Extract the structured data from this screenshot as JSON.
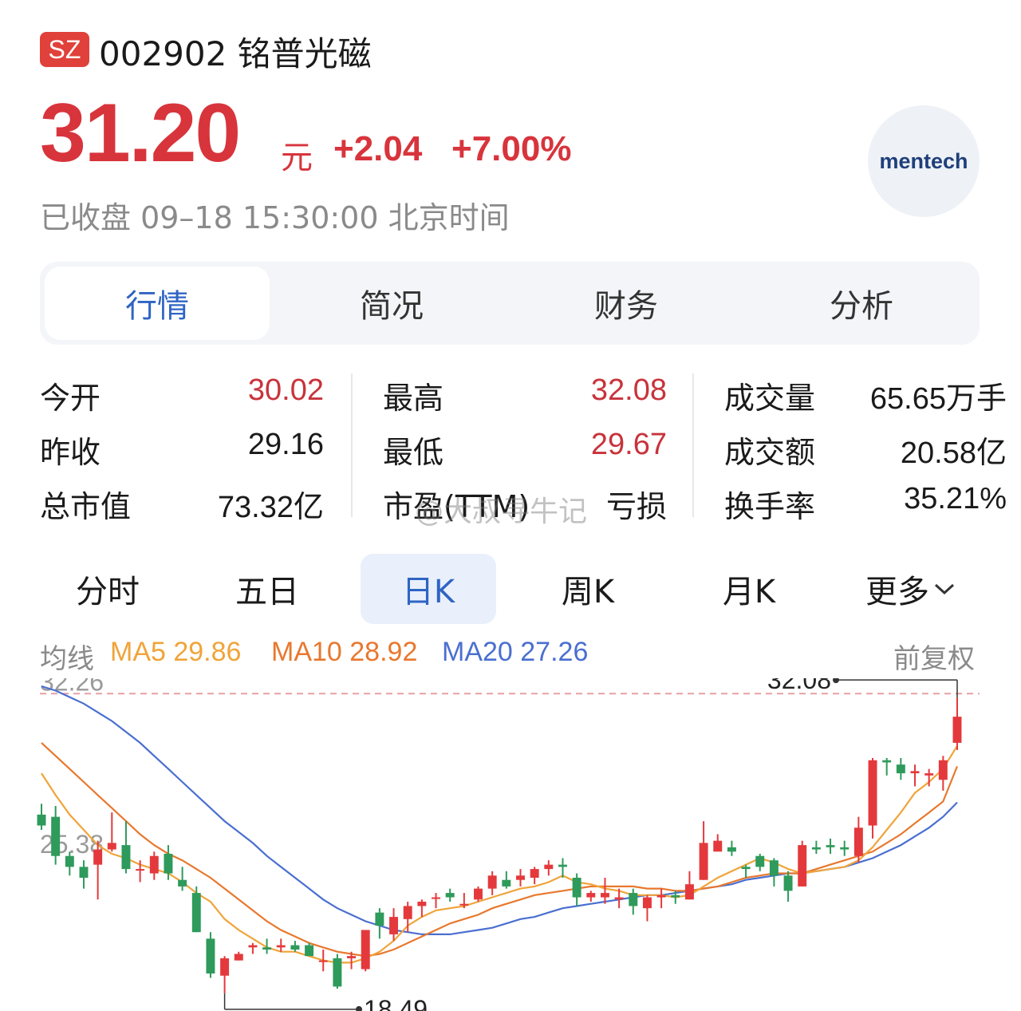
{
  "header": {
    "market_badge": "SZ",
    "code_name": "002902 铭普光磁",
    "price": "31.20",
    "price_unit": "元",
    "change": "+2.04",
    "change_pct": "+7.00%",
    "status": "已收盘 09–18 15:30:00 北京时间",
    "logo_text": "mentech"
  },
  "tabs": [
    {
      "label": "行情",
      "active": true
    },
    {
      "label": "简况",
      "active": false
    },
    {
      "label": "财务",
      "active": false
    },
    {
      "label": "分析",
      "active": false
    }
  ],
  "stats": [
    {
      "label": "今开",
      "value": "30.02",
      "color": "red"
    },
    {
      "label": "昨收",
      "value": "29.16",
      "color": "black"
    },
    {
      "label": "总市值",
      "value": "73.32亿",
      "color": "black"
    },
    {
      "label": "最高",
      "value": "32.08",
      "color": "red"
    },
    {
      "label": "最低",
      "value": "29.67",
      "color": "red"
    },
    {
      "label": "市盈(TTM)",
      "value": "亏损",
      "color": "black"
    },
    {
      "label": "成交量",
      "value": "65.65万手",
      "color": "black"
    },
    {
      "label": "成交额",
      "value": "20.58亿",
      "color": "black"
    },
    {
      "label": "换手率",
      "value": "35.21%",
      "color": "black"
    }
  ],
  "watermark": "@大叔寻牛记",
  "periods": [
    {
      "label": "分时",
      "active": false
    },
    {
      "label": "五日",
      "active": false
    },
    {
      "label": "日K",
      "active": true
    },
    {
      "label": "周K",
      "active": false
    },
    {
      "label": "月K",
      "active": false
    },
    {
      "label": "更多",
      "active": false
    }
  ],
  "ma_legend": {
    "label": "均线",
    "ma5": "MA5 29.86",
    "ma10": "MA10 28.92",
    "ma20": "MA20 27.26",
    "adjust": "前复权"
  },
  "colors": {
    "up": "#e4393c",
    "down": "#2e9a5b",
    "ma5": "#f0a43a",
    "ma10": "#e8782e",
    "ma20": "#4a6fd0",
    "accent": "#2f64c4"
  },
  "chart_data": {
    "type": "candlestick",
    "y_axis_labels": [
      "32.26",
      "25.38"
    ],
    "ylim": [
      18.3,
      32.6
    ],
    "high_marker": "32.08",
    "low_marker": "18.49",
    "candles": [
      [
        26.7,
        26.2,
        27.2,
        26.0
      ],
      [
        26.6,
        24.8,
        27.1,
        24.4
      ],
      [
        24.8,
        24.3,
        25.0,
        23.9
      ],
      [
        24.3,
        23.8,
        24.6,
        23.3
      ],
      [
        24.4,
        25.1,
        25.5,
        22.8
      ],
      [
        25.1,
        25.4,
        26.8,
        25.0
      ],
      [
        25.3,
        24.2,
        26.4,
        24.0
      ],
      [
        24.2,
        24.2,
        24.6,
        23.6
      ],
      [
        24.0,
        24.8,
        25.0,
        23.7
      ],
      [
        24.9,
        24.0,
        25.3,
        23.7
      ],
      [
        23.7,
        23.4,
        24.3,
        23.2
      ],
      [
        23.1,
        21.3,
        23.4,
        21.3
      ],
      [
        21.0,
        19.4,
        21.3,
        19.2
      ],
      [
        19.3,
        20.1,
        20.2,
        18.49
      ],
      [
        20.0,
        20.3,
        20.4,
        20.0
      ],
      [
        20.6,
        20.7,
        20.8,
        20.3
      ],
      [
        20.6,
        20.5,
        21.0,
        20.3
      ],
      [
        20.6,
        20.7,
        21.0,
        20.4
      ],
      [
        20.7,
        20.5,
        20.9,
        20.4
      ],
      [
        20.7,
        20.2,
        20.8,
        20.2
      ],
      [
        20.0,
        20.0,
        20.5,
        19.5
      ],
      [
        20.1,
        18.8,
        20.3,
        18.7
      ],
      [
        20.1,
        20.2,
        20.4,
        19.6
      ],
      [
        19.6,
        21.4,
        21.4,
        19.5
      ],
      [
        22.2,
        21.6,
        22.4,
        21.0
      ],
      [
        21.2,
        22.0,
        22.4,
        20.9
      ],
      [
        21.9,
        22.5,
        22.7,
        21.3
      ],
      [
        22.5,
        22.7,
        22.8,
        22.0
      ],
      [
        22.9,
        22.9,
        23.1,
        22.4
      ],
      [
        23.1,
        22.9,
        23.3,
        22.7
      ],
      [
        22.6,
        22.6,
        23.1,
        22.4
      ],
      [
        22.8,
        23.3,
        23.4,
        22.7
      ],
      [
        23.3,
        23.9,
        24.1,
        23.0
      ],
      [
        23.7,
        23.4,
        24.1,
        23.3
      ],
      [
        23.7,
        23.9,
        24.2,
        23.4
      ],
      [
        23.8,
        24.2,
        24.3,
        23.5
      ],
      [
        24.2,
        24.4,
        24.6,
        23.9
      ],
      [
        24.4,
        24.3,
        24.7,
        23.8
      ],
      [
        23.8,
        22.9,
        24.0,
        22.5
      ],
      [
        22.9,
        23.1,
        23.2,
        22.7
      ],
      [
        22.9,
        23.1,
        23.8,
        22.6
      ],
      [
        22.8,
        22.9,
        23.3,
        22.4
      ],
      [
        23.1,
        22.5,
        23.3,
        22.1
      ],
      [
        22.4,
        22.9,
        23.0,
        21.8
      ],
      [
        22.9,
        23.0,
        23.3,
        22.4
      ],
      [
        23.0,
        22.9,
        23.2,
        22.6
      ],
      [
        22.8,
        23.5,
        24.1,
        22.8
      ],
      [
        23.7,
        25.4,
        26.4,
        23.7
      ],
      [
        25.0,
        25.5,
        25.8,
        25.1
      ],
      [
        25.2,
        25.0,
        25.5,
        24.8
      ],
      [
        24.3,
        24.2,
        24.4,
        23.8
      ],
      [
        24.8,
        24.3,
        24.9,
        24.1
      ],
      [
        24.6,
        23.9,
        24.7,
        23.4
      ],
      [
        23.9,
        23.2,
        24.1,
        22.7
      ],
      [
        23.4,
        25.3,
        25.5,
        23.4
      ],
      [
        25.2,
        25.1,
        25.5,
        24.9
      ],
      [
        25.3,
        25.2,
        25.6,
        24.9
      ],
      [
        25.2,
        25.1,
        25.5,
        24.8
      ],
      [
        24.8,
        26.1,
        26.6,
        24.5
      ],
      [
        26.2,
        29.2,
        29.3,
        25.6
      ],
      [
        29.2,
        29.1,
        29.3,
        28.5
      ],
      [
        29.0,
        28.6,
        29.3,
        28.3
      ],
      [
        28.6,
        28.7,
        29.0,
        28.0
      ],
      [
        28.5,
        28.6,
        28.8,
        28.0
      ],
      [
        28.3,
        29.2,
        29.4,
        27.8
      ],
      [
        30.0,
        31.2,
        32.08,
        29.67
      ]
    ],
    "ma5": [
      28.6,
      27.6,
      26.7,
      26.0,
      25.3,
      24.9,
      24.7,
      24.4,
      24.2,
      24.0,
      23.6,
      23.1,
      22.7,
      21.9,
      21.4,
      21.0,
      20.6,
      20.4,
      20.4,
      20.2,
      20.0,
      19.9,
      19.9,
      20.1,
      20.4,
      20.9,
      21.6,
      22.0,
      22.3,
      22.4,
      22.5,
      22.7,
      22.9,
      23.1,
      23.3,
      23.4,
      23.6,
      23.9,
      23.6,
      23.5,
      23.3,
      23.2,
      23.0,
      23.0,
      23.0,
      22.9,
      23.0,
      23.4,
      23.8,
      24.1,
      24.4,
      24.7,
      24.5,
      24.2,
      24.0,
      24.1,
      24.2,
      24.3,
      24.6,
      25.2,
      26.0,
      26.8,
      27.7,
      28.2,
      28.8,
      29.86
    ],
    "ma10": [
      30.0,
      29.4,
      28.8,
      28.2,
      27.6,
      27.0,
      26.4,
      25.8,
      25.3,
      24.9,
      24.6,
      24.2,
      23.8,
      23.3,
      22.8,
      22.3,
      21.8,
      21.4,
      21.1,
      20.8,
      20.6,
      20.4,
      20.3,
      20.2,
      20.3,
      20.5,
      20.8,
      21.1,
      21.4,
      21.7,
      21.9,
      22.1,
      22.4,
      22.6,
      22.8,
      23.0,
      23.1,
      23.2,
      23.3,
      23.4,
      23.4,
      23.4,
      23.4,
      23.3,
      23.3,
      23.2,
      23.2,
      23.3,
      23.4,
      23.6,
      23.8,
      23.9,
      24.0,
      24.0,
      24.0,
      24.2,
      24.4,
      24.6,
      24.8,
      25.0,
      25.4,
      25.8,
      26.3,
      26.8,
      27.3,
      28.92
    ],
    "ma20": [
      32.6,
      32.4,
      32.1,
      31.8,
      31.4,
      31.0,
      30.5,
      30.0,
      29.4,
      28.8,
      28.2,
      27.6,
      27.0,
      26.4,
      25.9,
      25.4,
      24.8,
      24.3,
      23.8,
      23.3,
      22.8,
      22.4,
      22.1,
      21.8,
      21.6,
      21.4,
      21.3,
      21.2,
      21.2,
      21.2,
      21.3,
      21.4,
      21.5,
      21.7,
      21.9,
      22.0,
      22.2,
      22.4,
      22.5,
      22.6,
      22.7,
      22.8,
      22.9,
      23.0,
      23.0,
      23.1,
      23.2,
      23.3,
      23.4,
      23.5,
      23.7,
      23.8,
      23.9,
      24.0,
      24.0,
      24.1,
      24.2,
      24.3,
      24.5,
      24.7,
      25.0,
      25.3,
      25.7,
      26.1,
      26.6,
      27.26
    ]
  }
}
